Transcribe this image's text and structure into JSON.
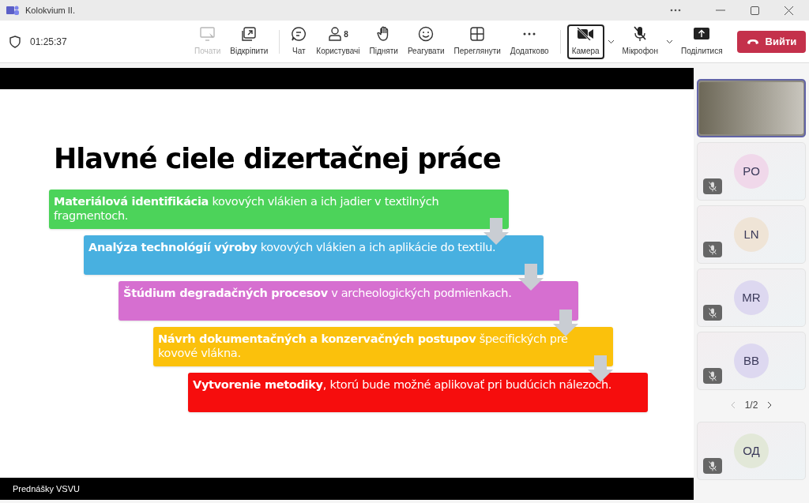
{
  "window": {
    "title": "Kolokvium II."
  },
  "meeting": {
    "timer": "01:25:37"
  },
  "toolbar": [
    {
      "kind": "share",
      "label": "Почати",
      "disabled": true,
      "selected": false
    },
    {
      "kind": "popout",
      "label": "Відкріпити",
      "disabled": false,
      "selected": false
    },
    {
      "kind": "divider"
    },
    {
      "kind": "chat",
      "label": "Чат",
      "disabled": false,
      "selected": false
    },
    {
      "kind": "people",
      "label": "Користувачі",
      "count": "8",
      "disabled": false,
      "selected": false
    },
    {
      "kind": "hand",
      "label": "Підняти",
      "disabled": false,
      "selected": false
    },
    {
      "kind": "react",
      "label": "Реагувати",
      "disabled": false,
      "selected": false
    },
    {
      "kind": "view",
      "label": "Переглянути",
      "disabled": false,
      "selected": false
    },
    {
      "kind": "more",
      "label": "Додатково",
      "disabled": false,
      "selected": false
    },
    {
      "kind": "divider"
    },
    {
      "kind": "camera",
      "label": "Камера",
      "disabled": false,
      "selected": true,
      "caret": true
    },
    {
      "kind": "mic",
      "label": "Мікрофон",
      "disabled": false,
      "selected": false,
      "caret": true
    },
    {
      "kind": "upload",
      "label": "Поділитися",
      "disabled": false,
      "selected": false
    }
  ],
  "leave_button": {
    "label": "Вийти"
  },
  "slide": {
    "title": "Hlavné ciele dizertačnej práce",
    "steps": [
      {
        "text": "**Materiálová identifikácia** kovových vlákien a ich jadier v textilných fragmentoch.",
        "color": "#4cd35a"
      },
      {
        "text": "**Analýza technológií výroby** kovových vlákien a ich aplikácie do textilu.",
        "color": "#48b0e0"
      },
      {
        "text": "**Štúdium degradačných procesov** v archeologických podmienkach.",
        "color": "#d66fd0"
      },
      {
        "text": "**Návrh dokumentačných a konzervačných postupov** špecifických pre kovové vlákna.",
        "color": "#fbc10c"
      },
      {
        "text": "**Vytvorenie metodiky**, ktorú bude možné aplikovať pri budúcich nálezoch.",
        "color": "#f60d0d"
      }
    ],
    "footer": "Prednášky VSVU"
  },
  "participants": [
    {
      "kind": "video",
      "selected": true
    },
    {
      "kind": "avatar",
      "initials": "PO",
      "color": "#f0d8ea",
      "muted": true,
      "selected": false
    },
    {
      "kind": "avatar",
      "initials": "LN",
      "color": "#efe4d6",
      "muted": true,
      "selected": false
    },
    {
      "kind": "avatar",
      "initials": "MR",
      "color": "#ddd8f0",
      "muted": true,
      "selected": false
    },
    {
      "kind": "avatar",
      "initials": "BB",
      "color": "#ddd8f0",
      "muted": true,
      "selected": false
    }
  ],
  "pager": {
    "label": "1/2"
  },
  "self": {
    "initials": "ОД",
    "color": "#e2e8d8",
    "muted": true
  }
}
